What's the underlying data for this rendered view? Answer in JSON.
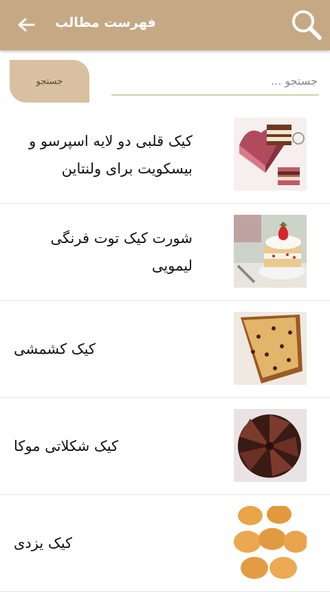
{
  "header": {
    "title": "فهرست مطالب",
    "back_icon": "arrow-left-icon",
    "search_icon": "search-icon",
    "color": "#c5a985"
  },
  "search": {
    "button_label": "جستجو",
    "placeholder": "جستجو ..."
  },
  "items": [
    {
      "title": "کیک قلبی دو لایه اسپرسو و بیسکویت برای ولنتاین",
      "image": "heart-cake-image"
    },
    {
      "title": "شورت کیک توت فرنگی لیمویی",
      "image": "strawberry-shortcake-image"
    },
    {
      "title": "کیک کشمشی",
      "image": "raisin-cake-image"
    },
    {
      "title": "کیک شکلاتی موکا",
      "image": "mocha-chocolate-cake-image"
    },
    {
      "title": "کیک یزدی",
      "image": "yazdi-cupcakes-image"
    }
  ]
}
